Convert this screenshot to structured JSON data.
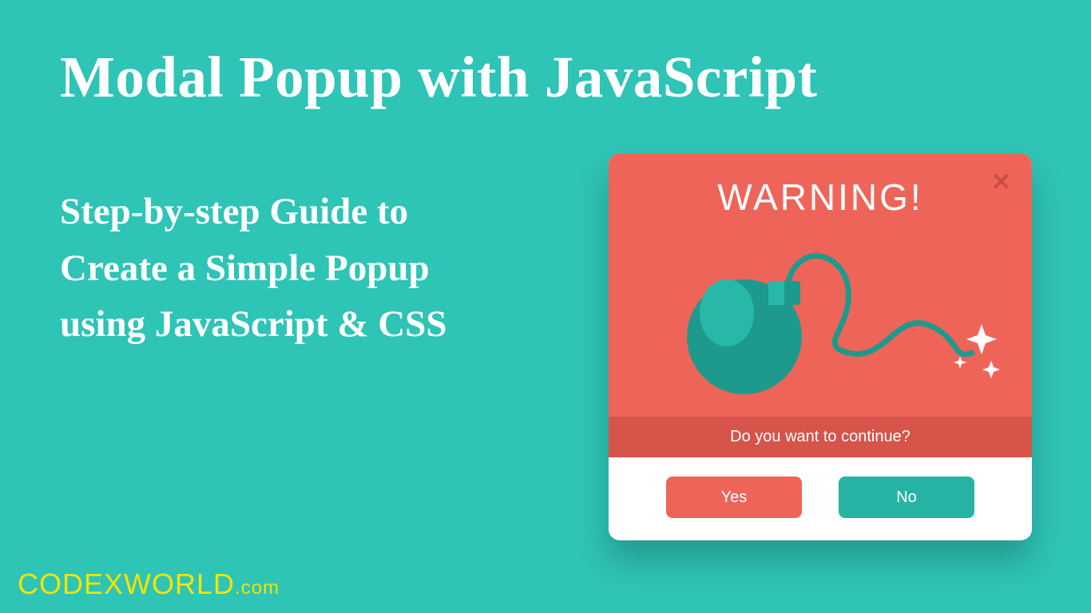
{
  "title": "Modal Popup with JavaScript",
  "subtitle_line1": "Step-by-step Guide to",
  "subtitle_line2": "Create a Simple Popup",
  "subtitle_line3": "using JavaScript & CSS",
  "watermark": {
    "brand": "CODEXWORLD",
    "domain": ".com"
  },
  "modal": {
    "heading": "WARNING!",
    "question": "Do you want to continue?",
    "yes_label": "Yes",
    "no_label": "No"
  },
  "colors": {
    "background": "#2ec4b6",
    "coral": "#ef6459",
    "coral_dark": "#d65449",
    "teal_btn": "#25b4a4",
    "yellow": "#f2e500"
  }
}
